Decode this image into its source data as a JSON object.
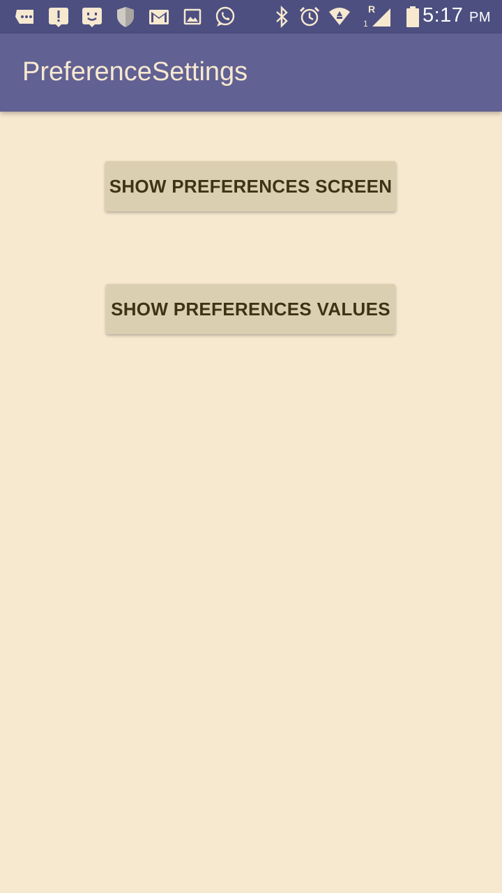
{
  "status_bar": {
    "icons": [
      "message-icon",
      "alert-icon",
      "chat-bot-icon",
      "shield-icon",
      "gmail-icon",
      "gallery-icon",
      "whatsapp-icon",
      "bluetooth-icon",
      "alarm-icon",
      "wifi-icon",
      "signal-icon",
      "battery-icon"
    ],
    "signal_roaming": "R",
    "signal_sim": "1",
    "time": "5:17",
    "ampm": "PM"
  },
  "app_bar": {
    "title": "PreferenceSettings"
  },
  "buttons": {
    "show_screen": "SHOW PREFERENCES SCREEN",
    "show_values": "SHOW PREFERENCES VALUES"
  },
  "colors": {
    "status_bar": "#4c4f80",
    "app_bar": "#626193",
    "background": "#f7e9d0",
    "button": "#dbcfb1",
    "button_text": "#3e3217"
  }
}
